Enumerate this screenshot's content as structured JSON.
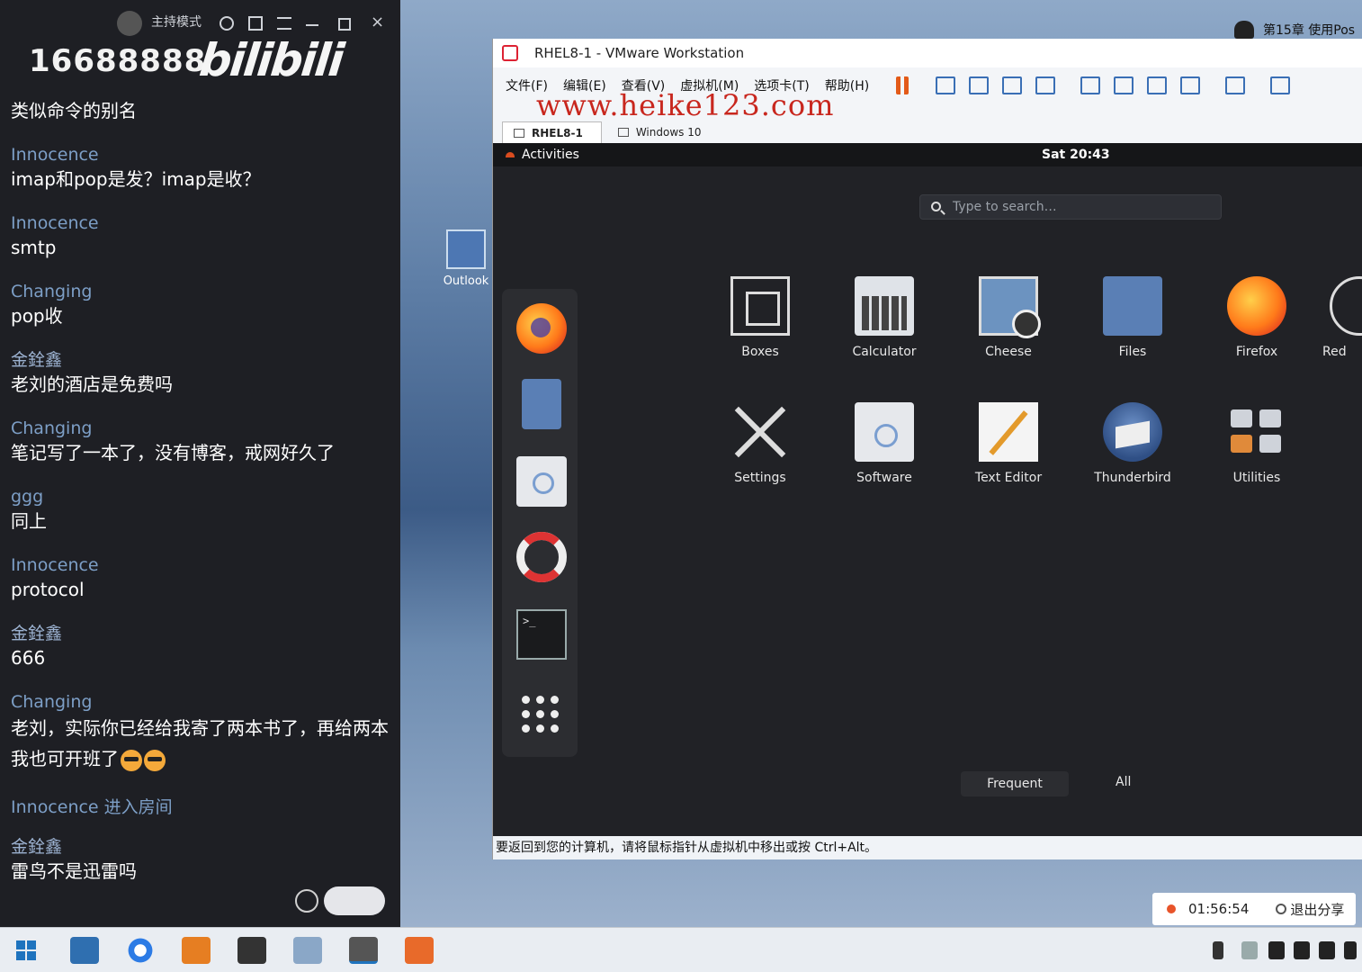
{
  "chat": {
    "top": {
      "host_mode": "主持模式"
    },
    "room_id": "16688888",
    "brand": "bilibili",
    "messages": [
      {
        "user": "",
        "text": "类似命令的别名"
      },
      {
        "user": "Innocence",
        "text": "imap和pop是发？imap是收？"
      },
      {
        "user": "Innocence",
        "text": "smtp"
      },
      {
        "user": "Changing",
        "text": "pop收"
      },
      {
        "user": "金銓鑫",
        "text": "老刘的酒店是免费吗"
      },
      {
        "user": "Changing",
        "text": "笔记写了一本了，没有博客，戒网好久了"
      },
      {
        "user": "ggg",
        "text": "同上"
      },
      {
        "user": "Innocence",
        "text": "protocol"
      },
      {
        "user": "金銓鑫",
        "text": "666"
      },
      {
        "user": "Changing",
        "text": "老刘，实际你已经给我寄了两本书了，再给两本我也可开班了"
      }
    ],
    "system_message": "Innocence 进入房间",
    "last_message": {
      "user": "金銓鑫",
      "text": "雷鸟不是迅雷吗"
    }
  },
  "desktop": {
    "icon_label": "Outlook"
  },
  "notification": {
    "text": "第15章 使用Pos"
  },
  "vmware": {
    "title": "RHEL8-1 - VMware Workstation",
    "menu": [
      "文件(F)",
      "编辑(E)",
      "查看(V)",
      "虚拟机(M)",
      "选项卡(T)",
      "帮助(H)"
    ],
    "watermark": "www.heike123.com",
    "tabs": [
      "RHEL8-1",
      "Windows 10"
    ],
    "status_bar": "要返回到您的计算机，请将鼠标指针从虚拟机中移出或按 Ctrl+Alt。"
  },
  "guest": {
    "activities": "Activities",
    "clock": "Sat 20:43",
    "search_placeholder": "Type to search…",
    "apps_row1": [
      "Boxes",
      "Calculator",
      "Cheese",
      "Files",
      "Firefox",
      "Red"
    ],
    "apps_row2": [
      "Settings",
      "Software",
      "Text Editor",
      "Thunderbird",
      "Utilities"
    ],
    "view_frequent": "Frequent",
    "view_all": "All"
  },
  "share": {
    "timer": "01:56:54",
    "exit_label": "退出分享"
  },
  "colors": {
    "chat_bg": "#1e1f24",
    "username": "#7d9fc7",
    "guest_bg": "#212226",
    "accent_orange": "#e35a18",
    "watermark": "#c8271e"
  }
}
